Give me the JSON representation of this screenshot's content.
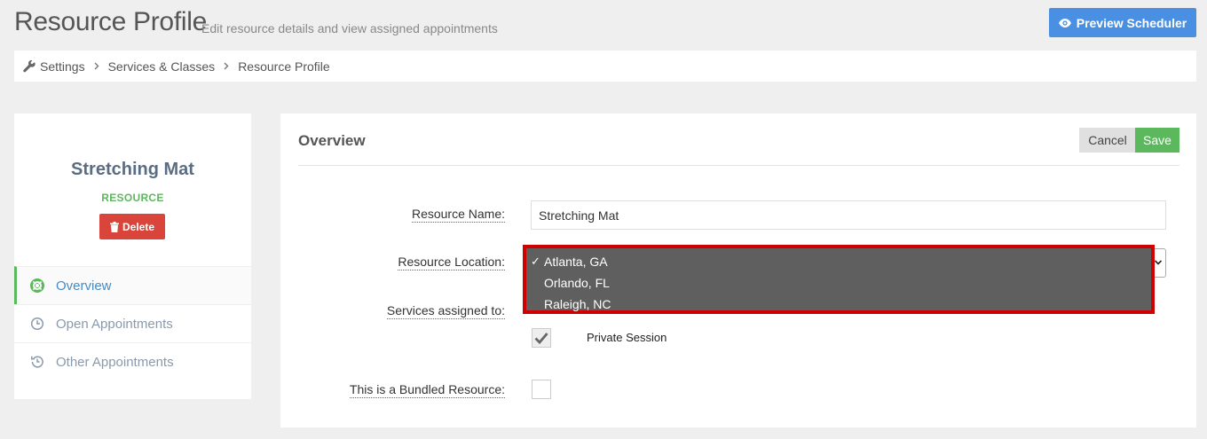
{
  "header": {
    "title": "Resource Profile",
    "subtitle": "Edit resource details and view assigned appointments",
    "preview_button": "Preview Scheduler"
  },
  "breadcrumb": {
    "items": [
      "Settings",
      "Services & Classes",
      "Resource Profile"
    ]
  },
  "resource": {
    "name": "Stretching Mat",
    "type": "RESOURCE",
    "delete_label": "Delete"
  },
  "nav": {
    "items": [
      {
        "label": "Overview",
        "icon": "life-ring-icon",
        "active": true
      },
      {
        "label": "Open Appointments",
        "icon": "clock-icon",
        "active": false
      },
      {
        "label": "Other Appointments",
        "icon": "history-icon",
        "active": false
      }
    ]
  },
  "overview": {
    "title": "Overview",
    "cancel_label": "Cancel",
    "save_label": "Save",
    "fields": {
      "name_label": "Resource Name:",
      "name_value": "Stretching Mat",
      "location_label": "Resource Location:",
      "services_label": "Services assigned to:",
      "bundled_label": "This is a Bundled Resource:"
    },
    "location_options": [
      "Atlanta, GA",
      "Orlando, FL",
      "Raleigh, NC"
    ],
    "location_selected": "Atlanta, GA",
    "services": [
      {
        "label": "Private Session",
        "checked": true
      }
    ],
    "bundled_checked": false
  },
  "colors": {
    "primary": "#4a90e2",
    "success": "#5cb85c",
    "danger": "#d9453a",
    "highlight": "#d10000",
    "dropdown_bg": "#5f5f5f"
  }
}
